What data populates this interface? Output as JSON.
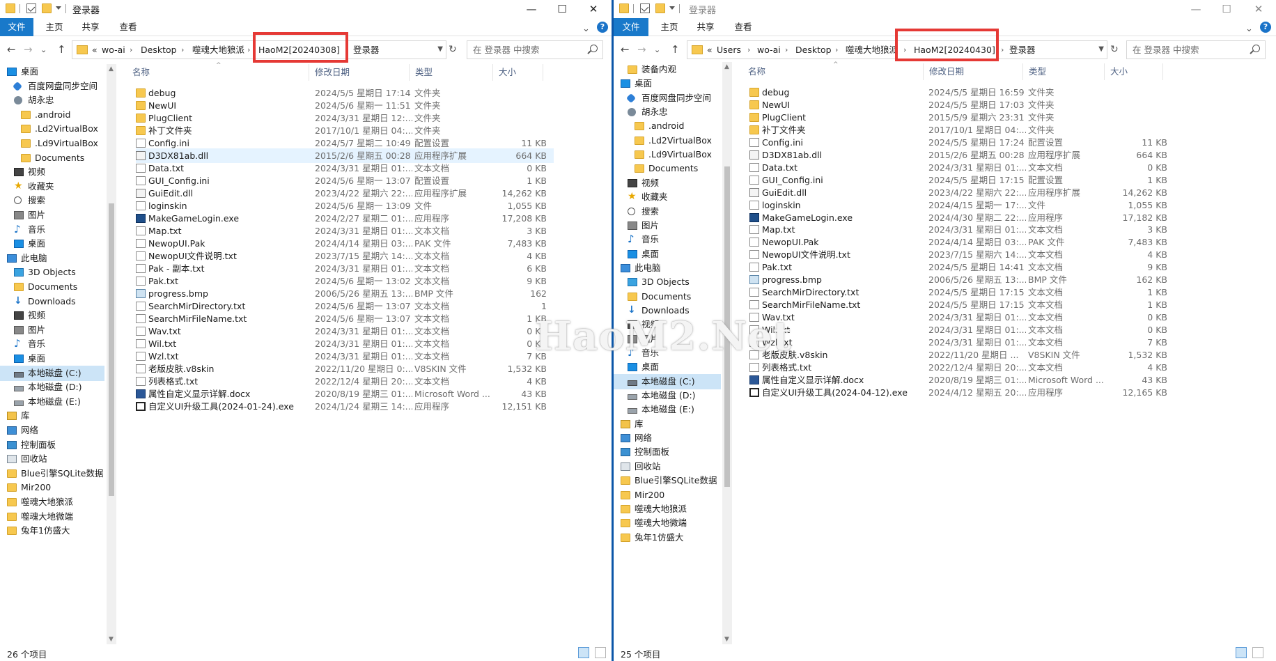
{
  "watermark": "HaoM2.Net",
  "left": {
    "title": "登录器",
    "controls": {
      "minimize": "—",
      "maximize": "☐",
      "close": "✕"
    },
    "ribbon": {
      "file": "文件",
      "home": "主页",
      "share": "共享",
      "view": "查看",
      "help": "?",
      "expand": "⌄"
    },
    "nav": {
      "back": "←",
      "forward": "→",
      "recent": "⌄",
      "up": "↑",
      "refresh": "↻"
    },
    "breadcrumb": [
      "«",
      "wo-ai",
      "Desktop",
      "噬魂大地狼派",
      "HaoM2[20240308]",
      "登录器"
    ],
    "search_placeholder": "在 登录器 中搜索",
    "columns": {
      "name": "名称",
      "date": "修改日期",
      "type": "类型",
      "size": "大小"
    },
    "sidebar": [
      {
        "label": "桌面",
        "icon": "desktop-icon"
      },
      {
        "label": "百度网盘同步空间",
        "icon": "cloud-icon"
      },
      {
        "label": "胡永忠",
        "icon": "user-icon"
      },
      {
        "label": ".android",
        "icon": "folder-icon"
      },
      {
        "label": ".Ld2VirtualBox",
        "icon": "folder-icon"
      },
      {
        "label": ".Ld9VirtualBox",
        "icon": "folder-icon"
      },
      {
        "label": "Documents",
        "icon": "folder-icon"
      },
      {
        "label": "视频",
        "icon": "video-icon"
      },
      {
        "label": "收藏夹",
        "icon": "star-icon"
      },
      {
        "label": "搜索",
        "icon": "search-icon"
      },
      {
        "label": "图片",
        "icon": "picture-icon"
      },
      {
        "label": "音乐",
        "icon": "music-icon"
      },
      {
        "label": "桌面",
        "icon": "desktop-icon"
      },
      {
        "label": "此电脑",
        "icon": "pc-icon"
      },
      {
        "label": "3D Objects",
        "icon": "3d-objects-icon"
      },
      {
        "label": "Documents",
        "icon": "documents-icon"
      },
      {
        "label": "Downloads",
        "icon": "downloads-icon"
      },
      {
        "label": "视频",
        "icon": "video-icon"
      },
      {
        "label": "图片",
        "icon": "picture-icon"
      },
      {
        "label": "音乐",
        "icon": "music-icon"
      },
      {
        "label": "桌面",
        "icon": "desktop-icon"
      },
      {
        "label": "本地磁盘 (C:)",
        "icon": "drive-c-icon",
        "selected": true
      },
      {
        "label": "本地磁盘 (D:)",
        "icon": "drive-icon"
      },
      {
        "label": "本地磁盘 (E:)",
        "icon": "drive-icon"
      },
      {
        "label": "库",
        "icon": "library-icon"
      },
      {
        "label": "网络",
        "icon": "network-icon"
      },
      {
        "label": "控制面板",
        "icon": "control-panel-icon"
      },
      {
        "label": "回收站",
        "icon": "recycle-bin-icon"
      },
      {
        "label": "Blue引擎SQLite数据",
        "icon": "folder-icon"
      },
      {
        "label": "Mir200",
        "icon": "folder-icon"
      },
      {
        "label": "噬魂大地狼派",
        "icon": "folder-icon"
      },
      {
        "label": "噬魂大地微端",
        "icon": "folder-icon"
      },
      {
        "label": "兔年1仿盛大",
        "icon": "folder-icon"
      }
    ],
    "files": [
      {
        "name": "debug",
        "date": "2024/5/5 星期日 17:14",
        "type": "文件夹",
        "size": "",
        "icon": "folder"
      },
      {
        "name": "NewUI",
        "date": "2024/5/6 星期一 11:51",
        "type": "文件夹",
        "size": "",
        "icon": "folder"
      },
      {
        "name": "PlugClient",
        "date": "2024/3/31 星期日 12:...",
        "type": "文件夹",
        "size": "",
        "icon": "folder"
      },
      {
        "name": "补丁文件夹",
        "date": "2017/10/1 星期日 04:...",
        "type": "文件夹",
        "size": "",
        "icon": "folder"
      },
      {
        "name": "Config.ini",
        "date": "2024/5/7 星期二 10:49",
        "type": "配置设置",
        "size": "11 KB",
        "icon": "doc"
      },
      {
        "name": "D3DX81ab.dll",
        "date": "2015/2/6 星期五 00:28",
        "type": "应用程序扩展",
        "size": "664 KB",
        "icon": "dll",
        "highlight": true
      },
      {
        "name": "Data.txt",
        "date": "2024/3/31 星期日 01:...",
        "type": "文本文档",
        "size": "0 KB",
        "icon": "doc"
      },
      {
        "name": "GUI_Config.ini",
        "date": "2024/5/6 星期一 13:07",
        "type": "配置设置",
        "size": "1 KB",
        "icon": "doc"
      },
      {
        "name": "GuiEdit.dll",
        "date": "2023/4/22 星期六 22:...",
        "type": "应用程序扩展",
        "size": "14,262 KB",
        "icon": "dll"
      },
      {
        "name": "loginskin",
        "date": "2024/5/6 星期一 13:09",
        "type": "文件",
        "size": "1,055 KB",
        "icon": "doc"
      },
      {
        "name": "MakeGameLogin.exe",
        "date": "2024/2/27 星期二 01:...",
        "type": "应用程序",
        "size": "17,208 KB",
        "icon": "exe"
      },
      {
        "name": "Map.txt",
        "date": "2024/3/31 星期日 01:...",
        "type": "文本文档",
        "size": "3 KB",
        "icon": "doc"
      },
      {
        "name": "NewopUI.Pak",
        "date": "2024/4/14 星期日 03:...",
        "type": "PAK 文件",
        "size": "7,483 KB",
        "icon": "doc"
      },
      {
        "name": "NewopUI文件说明.txt",
        "date": "2023/7/15 星期六 14:...",
        "type": "文本文档",
        "size": "4 KB",
        "icon": "doc"
      },
      {
        "name": "Pak - 副本.txt",
        "date": "2024/3/31 星期日 01:...",
        "type": "文本文档",
        "size": "6 KB",
        "icon": "doc"
      },
      {
        "name": "Pak.txt",
        "date": "2024/5/6 星期一 13:02",
        "type": "文本文档",
        "size": "9 KB",
        "icon": "doc"
      },
      {
        "name": "progress.bmp",
        "date": "2006/5/26 星期五 13:...",
        "type": "BMP 文件",
        "size": "162",
        "icon": "bmp"
      },
      {
        "name": "SearchMirDirectory.txt",
        "date": "2024/5/6 星期一 13:07",
        "type": "文本文档",
        "size": "1",
        "icon": "doc"
      },
      {
        "name": "SearchMirFileName.txt",
        "date": "2024/5/6 星期一 13:07",
        "type": "文本文档",
        "size": "1 KB",
        "icon": "doc"
      },
      {
        "name": "Wav.txt",
        "date": "2024/3/31 星期日 01:...",
        "type": "文本文档",
        "size": "0 KB",
        "icon": "doc"
      },
      {
        "name": "Wil.txt",
        "date": "2024/3/31 星期日 01:...",
        "type": "文本文档",
        "size": "0 KB",
        "icon": "doc"
      },
      {
        "name": "Wzl.txt",
        "date": "2024/3/31 星期日 01:...",
        "type": "文本文档",
        "size": "7 KB",
        "icon": "doc"
      },
      {
        "name": "老版皮肤.v8skin",
        "date": "2022/11/20 星期日 0:...",
        "type": "V8SKIN 文件",
        "size": "1,532 KB",
        "icon": "doc"
      },
      {
        "name": "列表格式.txt",
        "date": "2022/12/4 星期日 20:...",
        "type": "文本文档",
        "size": "4 KB",
        "icon": "doc"
      },
      {
        "name": "属性自定义显示详解.docx",
        "date": "2020/8/19 星期三 01:...",
        "type": "Microsoft Word ...",
        "size": "43 KB",
        "icon": "word"
      },
      {
        "name": "自定义UI升级工具(2024-01-24).exe",
        "date": "2024/1/24 星期三 14:...",
        "type": "应用程序",
        "size": "12,151 KB",
        "icon": "exe2"
      }
    ],
    "status": "26 个项目"
  },
  "right": {
    "title": "登录器",
    "controls": {
      "minimize": "—",
      "maximize": "☐",
      "close": "✕"
    },
    "ribbon": {
      "file": "文件",
      "home": "主页",
      "share": "共享",
      "view": "查看",
      "help": "?",
      "expand": "⌄"
    },
    "nav": {
      "back": "←",
      "forward": "→",
      "recent": "⌄",
      "up": "↑",
      "refresh": "↻"
    },
    "breadcrumb": [
      "«",
      "Users",
      "wo-ai",
      "Desktop",
      "噬魂大地狼派",
      "HaoM2[20240430]",
      "登录器"
    ],
    "search_placeholder": "在 登录器 中搜索",
    "columns": {
      "name": "名称",
      "date": "修改日期",
      "type": "类型",
      "size": "大小"
    },
    "sidebar": [
      {
        "label": "装备内观",
        "icon": "folder-icon"
      },
      {
        "label": "桌面",
        "icon": "desktop-icon"
      },
      {
        "label": "百度网盘同步空间",
        "icon": "cloud-icon"
      },
      {
        "label": "胡永忠",
        "icon": "user-icon"
      },
      {
        "label": ".android",
        "icon": "folder-icon"
      },
      {
        "label": ".Ld2VirtualBox",
        "icon": "folder-icon"
      },
      {
        "label": ".Ld9VirtualBox",
        "icon": "folder-icon"
      },
      {
        "label": "Documents",
        "icon": "folder-icon"
      },
      {
        "label": "视频",
        "icon": "video-icon"
      },
      {
        "label": "收藏夹",
        "icon": "star-icon"
      },
      {
        "label": "搜索",
        "icon": "search-icon"
      },
      {
        "label": "图片",
        "icon": "picture-icon"
      },
      {
        "label": "音乐",
        "icon": "music-icon"
      },
      {
        "label": "桌面",
        "icon": "desktop-icon"
      },
      {
        "label": "此电脑",
        "icon": "pc-icon"
      },
      {
        "label": "3D Objects",
        "icon": "3d-objects-icon"
      },
      {
        "label": "Documents",
        "icon": "documents-icon"
      },
      {
        "label": "Downloads",
        "icon": "downloads-icon"
      },
      {
        "label": "视频",
        "icon": "video-icon"
      },
      {
        "label": "图片",
        "icon": "picture-icon"
      },
      {
        "label": "音乐",
        "icon": "music-icon"
      },
      {
        "label": "桌面",
        "icon": "desktop-icon"
      },
      {
        "label": "本地磁盘 (C:)",
        "icon": "drive-c-icon",
        "selected": true
      },
      {
        "label": "本地磁盘 (D:)",
        "icon": "drive-icon"
      },
      {
        "label": "本地磁盘 (E:)",
        "icon": "drive-icon"
      },
      {
        "label": "库",
        "icon": "library-icon"
      },
      {
        "label": "网络",
        "icon": "network-icon"
      },
      {
        "label": "控制面板",
        "icon": "control-panel-icon"
      },
      {
        "label": "回收站",
        "icon": "recycle-bin-icon"
      },
      {
        "label": "Blue引擎SQLite数据",
        "icon": "folder-icon"
      },
      {
        "label": "Mir200",
        "icon": "folder-icon"
      },
      {
        "label": "噬魂大地狼派",
        "icon": "folder-icon"
      },
      {
        "label": "噬魂大地微端",
        "icon": "folder-icon"
      },
      {
        "label": "兔年1仿盛大",
        "icon": "folder-icon"
      }
    ],
    "files": [
      {
        "name": "debug",
        "date": "2024/5/5 星期日 16:59",
        "type": "文件夹",
        "size": "",
        "icon": "folder"
      },
      {
        "name": "NewUI",
        "date": "2024/5/5 星期日 17:03",
        "type": "文件夹",
        "size": "",
        "icon": "folder"
      },
      {
        "name": "PlugClient",
        "date": "2015/5/9 星期六 23:31",
        "type": "文件夹",
        "size": "",
        "icon": "folder"
      },
      {
        "name": "补丁文件夹",
        "date": "2017/10/1 星期日 04:...",
        "type": "文件夹",
        "size": "",
        "icon": "folder"
      },
      {
        "name": "Config.ini",
        "date": "2024/5/5 星期日 17:24",
        "type": "配置设置",
        "size": "11 KB",
        "icon": "doc"
      },
      {
        "name": "D3DX81ab.dll",
        "date": "2015/2/6 星期五 00:28",
        "type": "应用程序扩展",
        "size": "664 KB",
        "icon": "dll"
      },
      {
        "name": "Data.txt",
        "date": "2024/3/31 星期日 01:...",
        "type": "文本文档",
        "size": "0 KB",
        "icon": "doc"
      },
      {
        "name": "GUI_Config.ini",
        "date": "2024/5/5 星期日 17:15",
        "type": "配置设置",
        "size": "1 KB",
        "icon": "doc"
      },
      {
        "name": "GuiEdit.dll",
        "date": "2023/4/22 星期六 22:...",
        "type": "应用程序扩展",
        "size": "14,262 KB",
        "icon": "dll"
      },
      {
        "name": "loginskin",
        "date": "2024/4/15 星期一 17:...",
        "type": "文件",
        "size": "1,055 KB",
        "icon": "doc"
      },
      {
        "name": "MakeGameLogin.exe",
        "date": "2024/4/30 星期二 22:...",
        "type": "应用程序",
        "size": "17,182 KB",
        "icon": "exe"
      },
      {
        "name": "Map.txt",
        "date": "2024/3/31 星期日 01:...",
        "type": "文本文档",
        "size": "3 KB",
        "icon": "doc"
      },
      {
        "name": "NewopUI.Pak",
        "date": "2024/4/14 星期日 03:...",
        "type": "PAK 文件",
        "size": "7,483 KB",
        "icon": "doc"
      },
      {
        "name": "NewopUI文件说明.txt",
        "date": "2023/7/15 星期六 14:...",
        "type": "文本文档",
        "size": "4 KB",
        "icon": "doc"
      },
      {
        "name": "Pak.txt",
        "date": "2024/5/5 星期日 14:41",
        "type": "文本文档",
        "size": "9 KB",
        "icon": "doc"
      },
      {
        "name": "progress.bmp",
        "date": "2006/5/26 星期五 13:...",
        "type": "BMP 文件",
        "size": "162 KB",
        "icon": "bmp"
      },
      {
        "name": "SearchMirDirectory.txt",
        "date": "2024/5/5 星期日 17:15",
        "type": "文本文档",
        "size": "1 KB",
        "icon": "doc"
      },
      {
        "name": "SearchMirFileName.txt",
        "date": "2024/5/5 星期日 17:15",
        "type": "文本文档",
        "size": "1 KB",
        "icon": "doc"
      },
      {
        "name": "Wav.txt",
        "date": "2024/3/31 星期日 01:...",
        "type": "文本文档",
        "size": "0 KB",
        "icon": "doc"
      },
      {
        "name": "Wil.txt",
        "date": "2024/3/31 星期日 01:...",
        "type": "文本文档",
        "size": "0 KB",
        "icon": "doc"
      },
      {
        "name": "Wzl.txt",
        "date": "2024/3/31 星期日 01:...",
        "type": "文本文档",
        "size": "7 KB",
        "icon": "doc"
      },
      {
        "name": "老版皮肤.v8skin",
        "date": "2022/11/20 星期日 ...",
        "type": "V8SKIN 文件",
        "size": "1,532 KB",
        "icon": "doc"
      },
      {
        "name": "列表格式.txt",
        "date": "2022/12/4 星期日 20:...",
        "type": "文本文档",
        "size": "4 KB",
        "icon": "doc"
      },
      {
        "name": "属性自定义显示详解.docx",
        "date": "2020/8/19 星期三 01:...",
        "type": "Microsoft Word ...",
        "size": "43 KB",
        "icon": "word"
      },
      {
        "name": "自定义UI升级工具(2024-04-12).exe",
        "date": "2024/4/12 星期五 20:...",
        "type": "应用程序",
        "size": "12,165 KB",
        "icon": "exe2"
      }
    ],
    "status": "25 个项目"
  }
}
